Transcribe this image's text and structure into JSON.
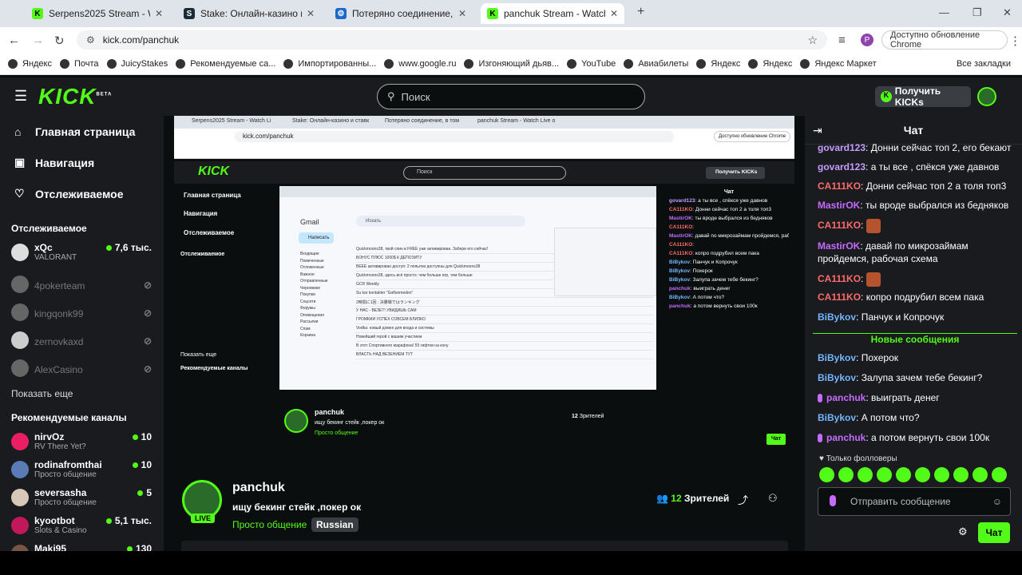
{
  "browser": {
    "tabs": [
      {
        "title": "Serpens2025 Stream - Watch Li",
        "fav": "K",
        "color": "#53fc18"
      },
      {
        "title": "Stake: Онлайн-казино и ставк",
        "fav": "S",
        "color": "#1a2c38"
      },
      {
        "title": "Потеряно соединение, в том",
        "fav": "⚙",
        "color": "#1b6ac9"
      },
      {
        "title": "panchuk Stream - Watch Live o",
        "fav": "K",
        "color": "#53fc18"
      }
    ],
    "url": "kick.com/panchuk",
    "update_label": "Доступно обновление Chrome",
    "profile_initial": "P",
    "bookmarks": [
      "Яндекс",
      "Почта",
      "JuicyStakes",
      "Рекомендуемые са...",
      "Импортированны...",
      "www.google.ru",
      "Изгоняющий дьяв...",
      "YouTube",
      "Авиабилеты",
      "Яндекс",
      "Яндекс",
      "Яндекс Маркет"
    ],
    "all_bookmarks": "Все закладки"
  },
  "kick": {
    "logo": "KICK",
    "logo_badge": "BETA",
    "search_placeholder": "Поиск",
    "get_kicks": "Получить KICKs"
  },
  "sidebar": {
    "nav": [
      {
        "label": "Главная страница",
        "icon": "⌂"
      },
      {
        "label": "Навигация",
        "icon": "▣"
      },
      {
        "label": "Отслеживаемое",
        "icon": "♡"
      }
    ],
    "following_title": "Отслеживаемое",
    "following": [
      {
        "name": "xQc",
        "sub": "VALORANT",
        "count": "7,6 тыс.",
        "online": true
      },
      {
        "name": "4pokerteam",
        "online": false
      },
      {
        "name": "kingqonk99",
        "online": false
      },
      {
        "name": "zernovkaxd",
        "online": false
      },
      {
        "name": "AlexCasino",
        "online": false
      }
    ],
    "show_more": "Показать еще",
    "recommended_title": "Рекомендуемые каналы",
    "recommended": [
      {
        "name": "nirvOz",
        "sub": "RV There Yet?",
        "count": "10"
      },
      {
        "name": "rodinafromthai",
        "sub": "Просто общение",
        "count": "10"
      },
      {
        "name": "seversasha",
        "sub": "Просто общение",
        "count": "5"
      },
      {
        "name": "kyootbot",
        "sub": "Slots & Casino",
        "count": "5,1 тыс."
      },
      {
        "name": "Maki95",
        "sub": "",
        "count": "130"
      }
    ]
  },
  "stream": {
    "channel": "panchuk",
    "title": "ищу бекинг стейк ,покер ок",
    "category": "Просто общение",
    "language": "Russian",
    "viewers_count": "12",
    "viewers_label": "Зрителей",
    "live": "LIVE"
  },
  "mirror": {
    "url": "kick.com/panchuk",
    "gmail_label": "Gmail",
    "gmail_search": "Искать",
    "gmail_compose": "Написать",
    "gmail_folders": [
      "Входящие",
      "Помеченные",
      "Отложенные",
      "Важное",
      "Отправленные",
      "Черновики",
      "Покупки",
      "Соцсети",
      "Форумы",
      "Оповещения",
      "Рассылки",
      "Спам",
      "Корзина"
    ],
    "gmail_rows": [
      "Quickmoons38, твой спин в FREE уже активирован. Забери его сейчас!",
      "БОНУС ПЛЮС 1000$ К ДЕПОЗИТУ",
      "ВЕЕЕ активирован доступ: 2 попытки доступны для Quickmoons38",
      "Quickmoons38, здесь всё просто: чем больше игр, тем больше",
      "GCR Weekly",
      "Su kar kontakter \"Golfunmeden\"",
      "2時間に1回 : 決勝戦ではランキング",
      "У НАС - ВЕЗЕТ! УВИДИШЬ САМ",
      "ГРОМКИЙ УСПЕХ СОВСЕМ БЛИЗКО",
      "Vodka: новый домен для входа и системы",
      "Новейший герой с вашим участием",
      "В этот Спортивного марафона! 55 гифтов на кону",
      "ВЛАСТЬ НАД ВЕЗЕНИЕМ ТУТ"
    ]
  },
  "chat": {
    "title": "Чат",
    "messages": [
      {
        "user": "govard123",
        "color": "#c59dff",
        "text": "Донни сейчас топ 2, его бекают"
      },
      {
        "user": "govard123",
        "color": "#c59dff",
        "text": "а ты все , спёкся уже давнов"
      },
      {
        "user": "CA111KO",
        "color": "#ff6b6b",
        "text": "Донни сейчас топ 2 а толя топ3"
      },
      {
        "user": "MastirOK",
        "color": "#c56bff",
        "text": "ты вроде выбрался из бедняков"
      },
      {
        "user": "CA111KO",
        "color": "#ff6b6b",
        "text": ""
      },
      {
        "user": "MastirOK",
        "color": "#c56bff",
        "text": "давай по микрозаймам пройдемся, рабочая схема"
      },
      {
        "user": "CA111KO",
        "color": "#ff6b6b",
        "text": ""
      },
      {
        "user": "CA111KO",
        "color": "#ff6b6b",
        "text": "копро подрубил всем пака"
      },
      {
        "user": "BiBykov",
        "color": "#74b6ff",
        "text": "Панчук и Копрочук"
      }
    ],
    "new_label": "Новые сообщения",
    "new_messages": [
      {
        "user": "BiBykov",
        "color": "#74b6ff",
        "text": "Похерок"
      },
      {
        "user": "BiBykov",
        "color": "#74b6ff",
        "text": "Залупа зачем тебе бекинг?"
      },
      {
        "user": "panchuk",
        "color": "#c56bff",
        "text": "выиграть денег",
        "mic": true
      },
      {
        "user": "BiBykov",
        "color": "#74b6ff",
        "text": "А потом что?"
      },
      {
        "user": "panchuk",
        "color": "#c56bff",
        "text": "а потом вернуть свои 100к",
        "mic": true
      }
    ],
    "followers_only": "Только фолловеры",
    "input_placeholder": "Отправить сообщение",
    "send_label": "Чат"
  }
}
